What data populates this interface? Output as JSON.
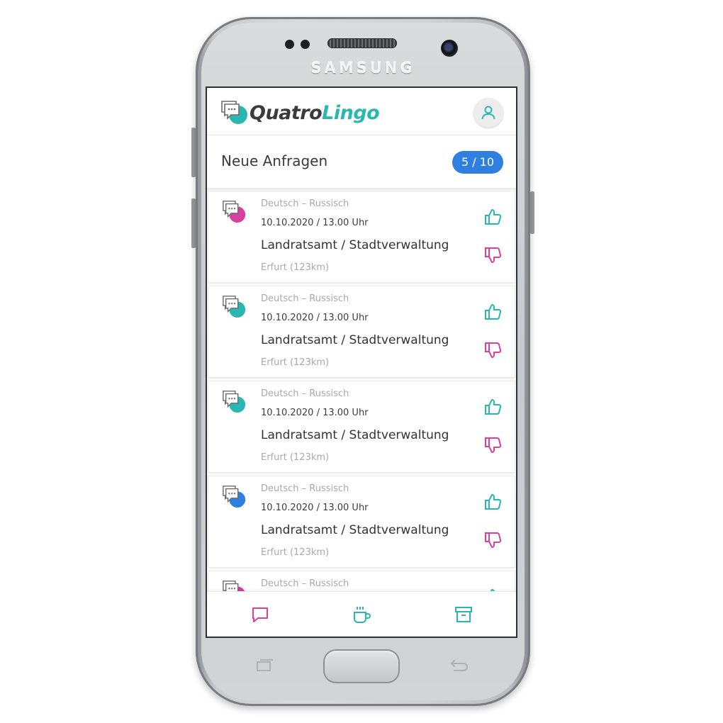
{
  "device": {
    "brand": "SAMSUNG"
  },
  "app": {
    "logo_part1": "Quatro",
    "logo_part2": "Lingo",
    "brand_colors": {
      "teal": "#2ab7b2",
      "magenta": "#d6409f",
      "blue": "#2f7fe0",
      "dark": "#3b3b3b"
    }
  },
  "header": {
    "avatar_icon": "user-icon"
  },
  "section": {
    "title": "Neue Anfragen",
    "counter": "5 / 10"
  },
  "requests": [
    {
      "languages": "Deutsch – Russisch",
      "datetime": "10.10.2020 / 13.00 Uhr",
      "place": "Landratsamt / Stadtverwaltung",
      "city": "Erfurt (123km)",
      "accent": "#d6409f"
    },
    {
      "languages": "Deutsch – Russisch",
      "datetime": "10.10.2020 / 13.00 Uhr",
      "place": "Landratsamt / Stadtverwaltung",
      "city": "Erfurt (123km)",
      "accent": "#2ab7b2"
    },
    {
      "languages": "Deutsch – Russisch",
      "datetime": "10.10.2020 / 13.00 Uhr",
      "place": "Landratsamt / Stadtverwaltung",
      "city": "Erfurt (123km)",
      "accent": "#2ab7b2"
    },
    {
      "languages": "Deutsch – Russisch",
      "datetime": "10.10.2020 / 13.00 Uhr",
      "place": "Landratsamt / Stadtverwaltung",
      "city": "Erfurt (123km)",
      "accent": "#2f7fe0"
    },
    {
      "languages": "Deutsch – Russisch",
      "datetime": "",
      "place": "",
      "city": "",
      "accent": "#d6409f"
    }
  ],
  "actions": {
    "like_icon": "thumbs-up-icon",
    "dislike_icon": "thumbs-down-icon",
    "like_color": "#2ab7b2",
    "dislike_color": "#d6409f"
  },
  "bottom_nav": [
    {
      "icon": "chat-icon",
      "color": "#d6409f"
    },
    {
      "icon": "coffee-cup-icon",
      "color": "#2ab7b2"
    },
    {
      "icon": "archive-box-icon",
      "color": "#2ab7b2"
    }
  ]
}
